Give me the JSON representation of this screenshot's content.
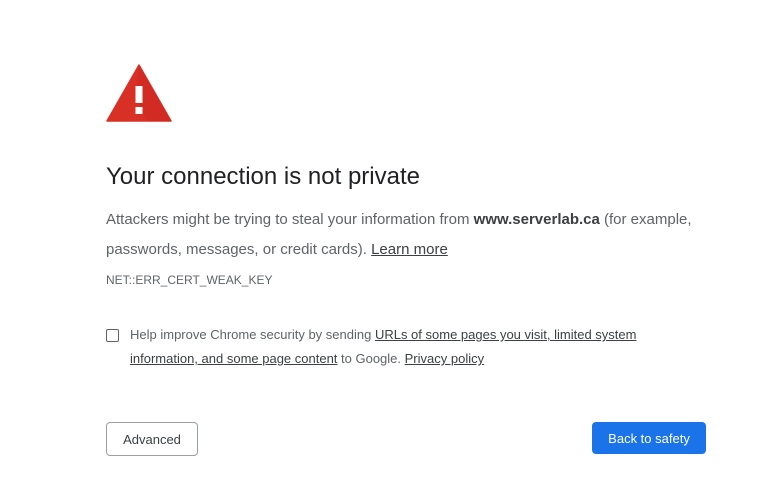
{
  "icon": {
    "name": "warning-triangle-icon",
    "color": "#d93025"
  },
  "heading": "Your connection is not private",
  "message": {
    "before": "Attackers might be trying to steal your information from ",
    "domain": "www.serverlab.ca",
    "after": " (for example, passwords, messages, or credit cards). ",
    "learn_more": "Learn more"
  },
  "error_code": "NET::ERR_CERT_WEAK_KEY",
  "optin": {
    "checked": false,
    "before": "Help improve Chrome security by sending ",
    "link": "URLs of some pages you visit, limited system information, and some page content",
    "middle": " to Google. ",
    "privacy_link": "Privacy policy"
  },
  "buttons": {
    "advanced": "Advanced",
    "back_to_safety": "Back to safety"
  },
  "colors": {
    "primary_button": "#1a73e8",
    "text": "#202124",
    "secondary_text": "#5f6368"
  }
}
